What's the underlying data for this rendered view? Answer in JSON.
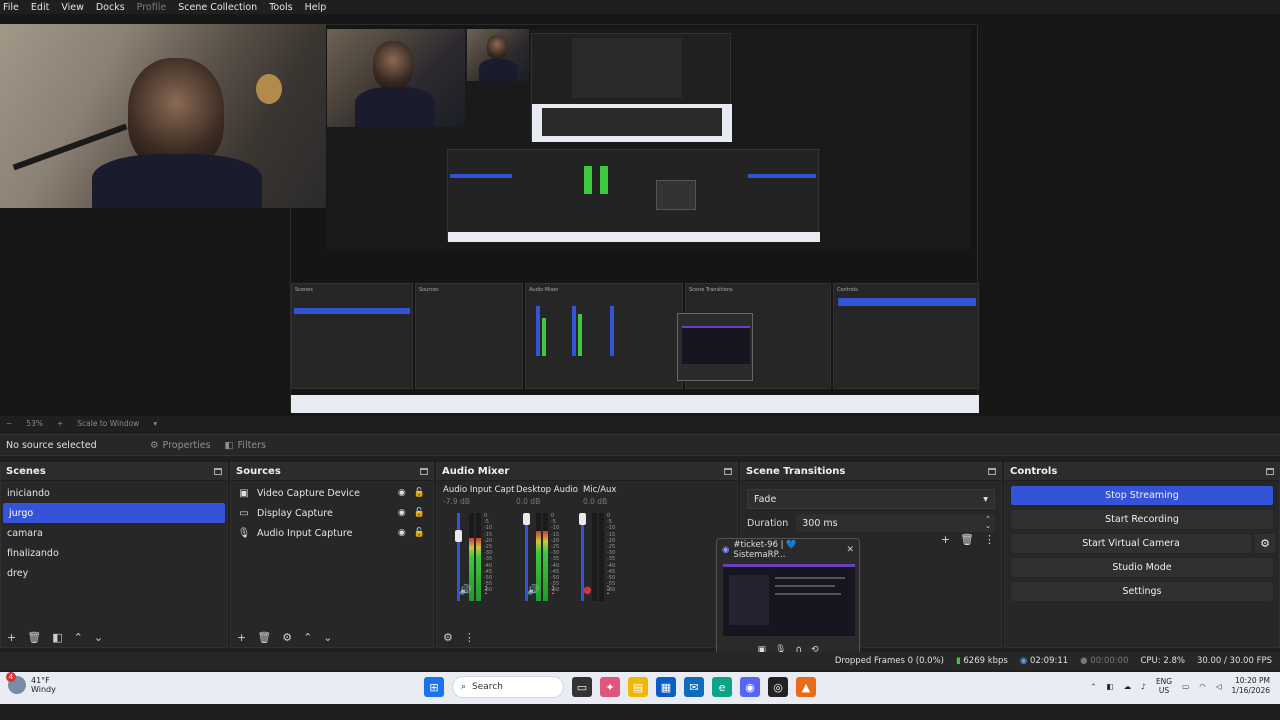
{
  "menu": [
    "File",
    "Edit",
    "View",
    "Docks",
    "Profile",
    "Scene Collection",
    "Tools",
    "Help"
  ],
  "zoombar": {
    "zoom": "53%",
    "fit": "Scale to Window"
  },
  "sourcebar": {
    "no_source": "No source selected",
    "properties": "Properties",
    "filters": "Filters"
  },
  "scenes": {
    "title": "Scenes",
    "items": [
      "iniciando",
      "jurgo",
      "camara",
      "finalizando",
      "drey"
    ],
    "selected": "jurgo"
  },
  "sources": {
    "title": "Sources",
    "items": [
      {
        "label": "Video Capture Device",
        "icon": "camera-icon"
      },
      {
        "label": "Display Capture",
        "icon": "monitor-icon"
      },
      {
        "label": "Audio Input Capture",
        "icon": "microphone-icon"
      }
    ]
  },
  "mixer": {
    "title": "Audio Mixer",
    "channels": [
      {
        "name": "Audio Input Captu",
        "db": "-7.9 dB",
        "level": 0.72,
        "fader": 0.78
      },
      {
        "name": "Desktop Audio",
        "db": "0.0 dB",
        "level": 0.8,
        "fader": 1.0
      },
      {
        "name": "Mic/Aux",
        "db": "0.0 dB",
        "level": 0.0,
        "fader": 1.0
      }
    ],
    "scale": [
      "0",
      "-5",
      "-10",
      "-15",
      "-20",
      "-25",
      "-30",
      "-35",
      "-40",
      "-45",
      "-50",
      "-55",
      "-60"
    ]
  },
  "transitions": {
    "title": "Scene Transitions",
    "type": "Fade",
    "duration_label": "Duration",
    "duration": "300 ms"
  },
  "controls": {
    "title": "Controls",
    "stop_streaming": "Stop Streaming",
    "start_recording": "Start Recording",
    "start_virtual_camera": "Start Virtual Camera",
    "studio_mode": "Studio Mode",
    "settings": "Settings"
  },
  "popup": {
    "title": "#ticket-96 | 💙 SistemaRP..."
  },
  "status": {
    "dropped": "Dropped Frames 0 (0.0%)",
    "bitrate": "6269 kbps",
    "stream_time": "02:09:11",
    "rec_time": "00:00:00",
    "cpu": "CPU: 2.8%",
    "fps": "30.00 / 30.00 FPS"
  },
  "taskbar": {
    "temp": "41°F",
    "weather": "Windy",
    "badge": "4",
    "search": "Search",
    "lang": "ENG",
    "region": "US",
    "time": "10:20 PM",
    "date": "1/16/2026"
  },
  "colors": {
    "accent": "#3553d9",
    "panel": "#272727",
    "bg": "#1f1f1f"
  }
}
